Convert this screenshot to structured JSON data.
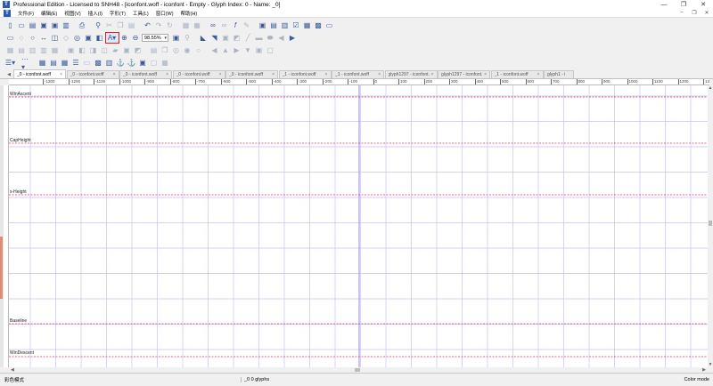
{
  "window": {
    "title": "Professional Edition - Licensed to SNH48 - [iconfont.woff - iconfont - Empty - Glyph Index: 0 - Name: _0]",
    "app_icon": "T",
    "minimize": "—",
    "restore": "❐",
    "close": "✕"
  },
  "menu": {
    "items": [
      "文件(F)",
      "编辑(E)",
      "视图(V)",
      "插入(I)",
      "字形(T)",
      "工具(L)",
      "窗口(W)",
      "帮助(H)"
    ],
    "right_controls": [
      "–",
      "❐",
      "✕"
    ]
  },
  "toolbar": {
    "zoom_value": "98.55%"
  },
  "tabs": [
    {
      "label": "_0 - iconfont.woff",
      "active": true
    },
    {
      "label": "_0 - iconfont.woff",
      "active": false
    },
    {
      "label": "_0 - iconfont.woff",
      "active": false
    },
    {
      "label": "_0 - iconfont.woff",
      "active": false
    },
    {
      "label": "_0 - iconfont.woff",
      "active": false
    },
    {
      "label": "_1 - iconfont.woff",
      "active": false
    },
    {
      "label": "_1 - iconfont.woff",
      "active": false
    },
    {
      "label": "glyph1297 - iconfont.woff",
      "active": false
    },
    {
      "label": "glyph1297 - iconfont.woff",
      "active": false
    },
    {
      "label": "_1 - iconfont.woff",
      "active": false
    },
    {
      "label": "glyph1 - i",
      "active": false
    }
  ],
  "ruler": {
    "ticks": [
      "-1300",
      "-1200",
      "-1100",
      "-1000",
      "-900",
      "-800",
      "-700",
      "-600",
      "-500",
      "-400",
      "-300",
      "-200",
      "-100",
      "0",
      "100",
      "200",
      "300",
      "400",
      "500",
      "600",
      "700",
      "800",
      "900",
      "1000",
      "1100",
      "1200",
      "1300"
    ]
  },
  "metrics": {
    "win_ascent": "WinAscent",
    "cap_height": "CapHeight",
    "x_height": "x-Height",
    "baseline": "Baseline",
    "win_descent": "WinDescent"
  },
  "colors": {
    "grid_line": "#c9c2ee",
    "metric_line": "#e0306a",
    "highlight_border": "#e02020"
  },
  "status": {
    "left": "彩色模式",
    "middle": "_0   0 glyphs",
    "right": "Color mode"
  }
}
